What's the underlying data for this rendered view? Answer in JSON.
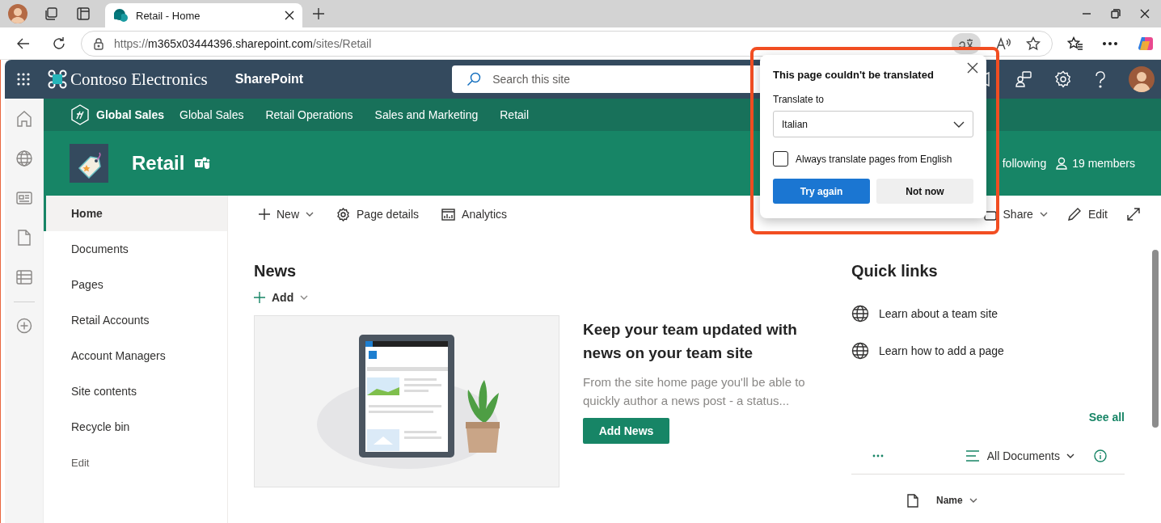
{
  "browser": {
    "tab_title": "Retail - Home",
    "url": {
      "scheme": "https://",
      "host": "m365x03444396.sharepoint.com",
      "path": "/sites/Retail"
    }
  },
  "suite_bar": {
    "brand": "Contoso Electronics",
    "app": "SharePoint",
    "search": {
      "placeholder": "Search this site"
    }
  },
  "hub_nav": {
    "title": "Global Sales",
    "links": [
      {
        "label": "Global Sales"
      },
      {
        "label": "Retail Operations"
      },
      {
        "label": "Sales and Marketing"
      },
      {
        "label": "Retail"
      }
    ]
  },
  "site_header": {
    "title": "Retail",
    "follow": "following",
    "members": "19 members"
  },
  "left_nav": {
    "items": [
      {
        "label": "Home",
        "selected": true,
        "kind": "link"
      },
      {
        "label": "Documents",
        "selected": false,
        "kind": "link"
      },
      {
        "label": "Pages",
        "selected": false,
        "kind": "link"
      },
      {
        "label": "Retail Accounts",
        "selected": false,
        "kind": "link"
      },
      {
        "label": "Account Managers",
        "selected": false,
        "kind": "link"
      },
      {
        "label": "Site contents",
        "selected": false,
        "kind": "link"
      },
      {
        "label": "Recycle bin",
        "selected": false,
        "kind": "link"
      },
      {
        "label": "Edit",
        "selected": false,
        "kind": "edit"
      }
    ]
  },
  "command_bar": {
    "left": [
      {
        "label": "New",
        "has_menu": true
      },
      {
        "label": "Page details",
        "has_menu": false
      },
      {
        "label": "Analytics",
        "has_menu": false
      }
    ],
    "right": [
      {
        "label": "Share",
        "has_menu": true
      },
      {
        "label": "Edit",
        "has_menu": false
      }
    ]
  },
  "news": {
    "title": "News",
    "add": "Add",
    "card": {
      "heading": "Keep your team updated with news on your team site",
      "body": "From the site home page you'll be able to quickly author a news post - a status...",
      "button": "Add News"
    }
  },
  "quick_links": {
    "title": "Quick links",
    "links": [
      "Learn about a team site",
      "Learn how to add a page"
    ]
  },
  "documents": {
    "see_all": "See all",
    "view": "All Documents",
    "columns": [
      "Name"
    ]
  },
  "translate_popup": {
    "title": "This page couldn't be translated",
    "label": "Translate to",
    "language": "Italian",
    "always": {
      "label": "Always translate pages from English",
      "checked": false
    },
    "buttons": [
      {
        "label": "Try again",
        "kind": "primary"
      },
      {
        "label": "Not now",
        "kind": "secondary"
      }
    ]
  }
}
